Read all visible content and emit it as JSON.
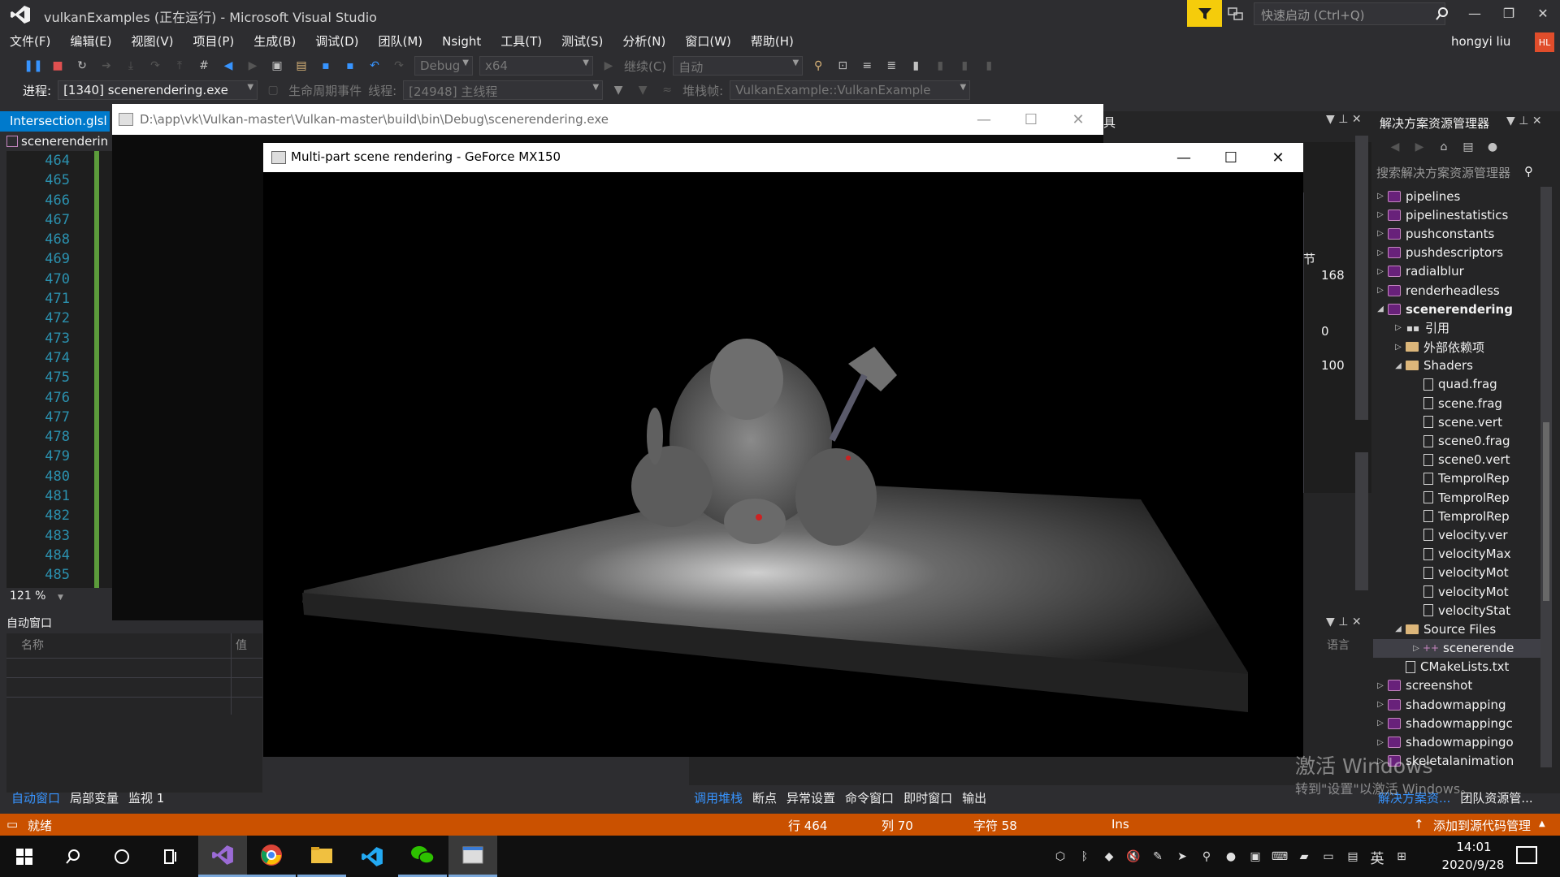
{
  "window": {
    "title": "vulkanExamples (正在运行) - Microsoft Visual Studio",
    "quick_launch_placeholder": "快速启动 (Ctrl+Q)",
    "user_name": "hongyi liu",
    "user_initials": "HL"
  },
  "menu": [
    "文件(F)",
    "编辑(E)",
    "视图(V)",
    "项目(P)",
    "生成(B)",
    "调试(D)",
    "团队(M)",
    "Nsight",
    "工具(T)",
    "测试(S)",
    "分析(N)",
    "窗口(W)",
    "帮助(H)"
  ],
  "toolbar": {
    "config": "Debug",
    "platform": "x64",
    "continue_label": "继续(C)",
    "auto_label": "自动"
  },
  "debug_location": {
    "process_label": "进程:",
    "process_value": "[1340] scenerendering.exe",
    "lifecycle_label": "生命周期事件",
    "thread_label": "线程:",
    "thread_value": "[24948] 主线程",
    "stackframe_label": "堆栈帧:",
    "stackframe_value": "VulkanExample::VulkanExample"
  },
  "editor": {
    "tab_label": "Intersection.glsl",
    "file_combo": "scenerenderin",
    "line_numbers": [
      "464",
      "465",
      "466",
      "467",
      "468",
      "469",
      "470",
      "471",
      "472",
      "473",
      "474",
      "475",
      "476",
      "477",
      "478",
      "479",
      "480",
      "481",
      "482",
      "483",
      "484",
      "485"
    ],
    "zoom": "121 %"
  },
  "autos": {
    "title": "自动窗口",
    "col_name": "名称",
    "col_value": "值",
    "tabs": [
      "自动窗口",
      "局部变量",
      "监视 1"
    ]
  },
  "console": {
    "path": "D:\\app\\vk\\Vulkan-master\\Vulkan-master\\build\\bin\\Debug\\scenerendering.exe"
  },
  "render_window": {
    "title": "Multi-part scene rendering - GeForce MX150"
  },
  "toolbox": {
    "title": "具",
    "section_label": "节",
    "values": [
      "168",
      "0",
      "100"
    ],
    "lang_label": "语言"
  },
  "bottom_tabs_mid": [
    "调用堆栈",
    "断点",
    "异常设置",
    "命令窗口",
    "即时窗口",
    "输出"
  ],
  "solution_explorer": {
    "title": "解决方案资源管理器",
    "search_placeholder": "搜索解决方案资源管理器",
    "items": [
      {
        "label": "pipelines",
        "type": "proj",
        "indent": 0,
        "arrow": "▷"
      },
      {
        "label": "pipelinestatistics",
        "type": "proj",
        "indent": 0,
        "arrow": "▷"
      },
      {
        "label": "pushconstants",
        "type": "proj",
        "indent": 0,
        "arrow": "▷"
      },
      {
        "label": "pushdescriptors",
        "type": "proj",
        "indent": 0,
        "arrow": "▷"
      },
      {
        "label": "radialblur",
        "type": "proj",
        "indent": 0,
        "arrow": "▷"
      },
      {
        "label": "renderheadless",
        "type": "proj",
        "indent": 0,
        "arrow": "▷"
      },
      {
        "label": "scenerendering",
        "type": "proj",
        "indent": 0,
        "arrow": "◢",
        "bold": true
      },
      {
        "label": "引用",
        "type": "ref",
        "indent": 1,
        "arrow": "▷"
      },
      {
        "label": "外部依赖项",
        "type": "folder",
        "indent": 1,
        "arrow": "▷"
      },
      {
        "label": "Shaders",
        "type": "folder",
        "indent": 1,
        "arrow": "◢"
      },
      {
        "label": "quad.frag",
        "type": "file",
        "indent": 2,
        "arrow": ""
      },
      {
        "label": "scene.frag",
        "type": "file",
        "indent": 2,
        "arrow": ""
      },
      {
        "label": "scene.vert",
        "type": "file",
        "indent": 2,
        "arrow": ""
      },
      {
        "label": "scene0.frag",
        "type": "file",
        "indent": 2,
        "arrow": ""
      },
      {
        "label": "scene0.vert",
        "type": "file",
        "indent": 2,
        "arrow": ""
      },
      {
        "label": "TemprolRep",
        "type": "file",
        "indent": 2,
        "arrow": ""
      },
      {
        "label": "TemprolRep",
        "type": "file",
        "indent": 2,
        "arrow": ""
      },
      {
        "label": "TemprolRep",
        "type": "file",
        "indent": 2,
        "arrow": ""
      },
      {
        "label": "velocity.ver",
        "type": "file",
        "indent": 2,
        "arrow": ""
      },
      {
        "label": "velocityMax",
        "type": "file",
        "indent": 2,
        "arrow": ""
      },
      {
        "label": "velocityMot",
        "type": "file",
        "indent": 2,
        "arrow": ""
      },
      {
        "label": "velocityMot",
        "type": "file",
        "indent": 2,
        "arrow": ""
      },
      {
        "label": "velocityStat",
        "type": "file",
        "indent": 2,
        "arrow": ""
      },
      {
        "label": "Source Files",
        "type": "folder",
        "indent": 1,
        "arrow": "◢"
      },
      {
        "label": "scenerende",
        "type": "cpp",
        "indent": 2,
        "arrow": "▷",
        "selected": true
      },
      {
        "label": "CMakeLists.txt",
        "type": "file",
        "indent": 1,
        "arrow": ""
      },
      {
        "label": "screenshot",
        "type": "proj",
        "indent": 0,
        "arrow": "▷"
      },
      {
        "label": "shadowmapping",
        "type": "proj",
        "indent": 0,
        "arrow": "▷"
      },
      {
        "label": "shadowmappingc",
        "type": "proj",
        "indent": 0,
        "arrow": "▷"
      },
      {
        "label": "shadowmappingo",
        "type": "proj",
        "indent": 0,
        "arrow": "▷"
      },
      {
        "label": "skeletalanimation",
        "type": "proj",
        "indent": 0,
        "arrow": "▷"
      }
    ],
    "bottom_tabs": [
      "解决方案资...",
      "团队资源管..."
    ]
  },
  "watermark": {
    "line1": "激活 Windows",
    "line2": "转到\"设置\"以激活 Windows。"
  },
  "status": {
    "ready": "就绪",
    "line": "行 464",
    "col": "列 70",
    "char": "字符 58",
    "mode": "Ins",
    "source_control": "添加到源代码管理"
  },
  "taskbar": {
    "time": "14:01",
    "date": "2020/9/28",
    "ime": "英",
    "apps": [
      "start-icon",
      "search-icon",
      "cortana-icon",
      "task-view-icon",
      "visual-studio-icon",
      "chrome-icon",
      "file-explorer-icon",
      "vscode-icon",
      "wechat-icon",
      "console-app-icon"
    ]
  },
  "colors": {
    "status_bar": "#ca5100",
    "accent": "#007acc",
    "filter_yellow": "#f5cc0b"
  }
}
